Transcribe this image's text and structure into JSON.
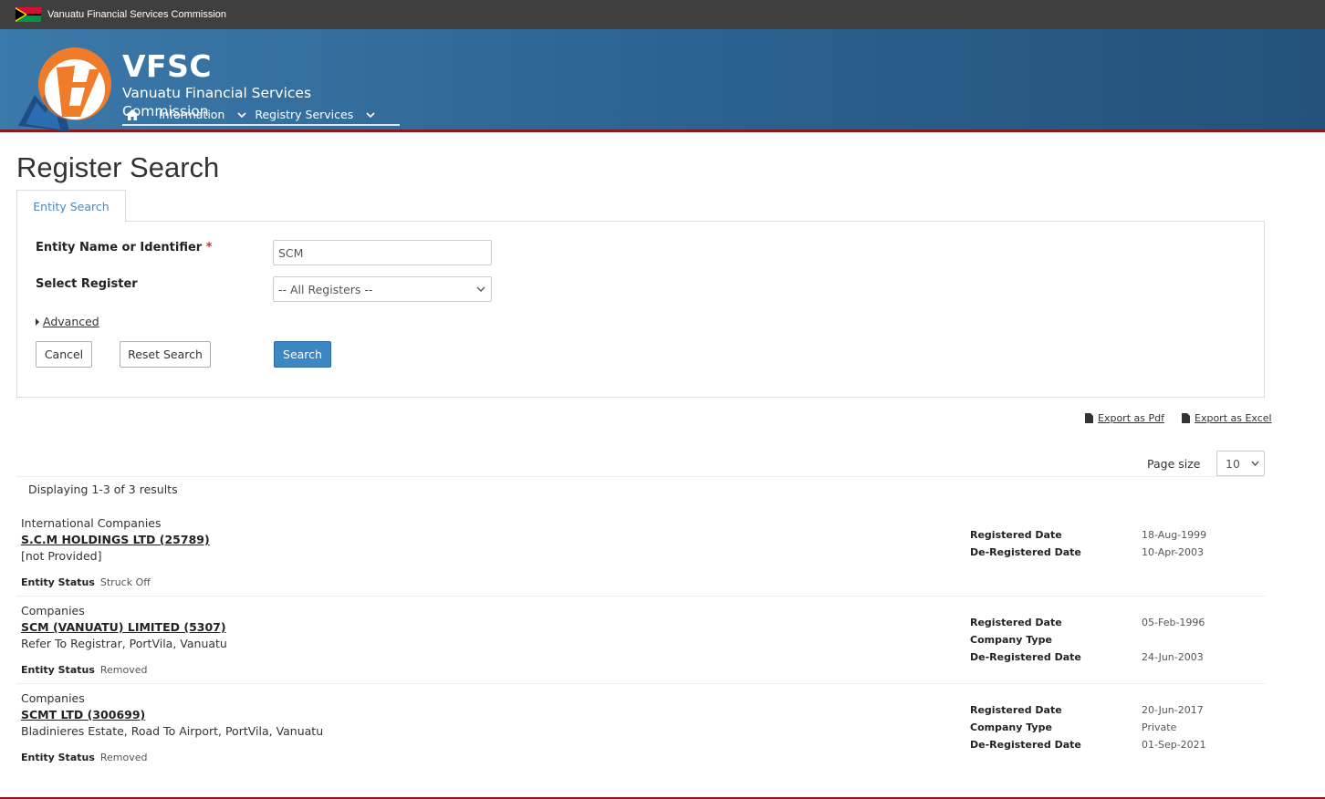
{
  "topbar": {
    "org_name": "Vanuatu Financial Services Commission"
  },
  "brand": {
    "abbr": "VFSC",
    "full_name": "Vanuatu Financial Services Commission"
  },
  "nav": {
    "items": [
      {
        "label": "Information"
      },
      {
        "label": "Registry Services"
      }
    ]
  },
  "page": {
    "title": "Register Search",
    "tab": "Entity Search"
  },
  "form": {
    "entity_label": "Entity Name or Identifier",
    "required_mark": "*",
    "entity_value": "SCM",
    "register_label": "Select Register",
    "register_value": "-- All Registers --",
    "advanced_label": "Advanced",
    "cancel_label": "Cancel",
    "reset_label": "Reset Search",
    "search_label": "Search"
  },
  "export": {
    "pdf_label": "Export as Pdf",
    "excel_label": "Export as Excel"
  },
  "pagination": {
    "page_size_label": "Page size",
    "page_size_value": "10",
    "summary": "Displaying 1-3 of 3 results"
  },
  "results": [
    {
      "type": "International Companies",
      "name": "S.C.M HOLDINGS LTD (25789)",
      "address": "[not Provided]",
      "status_label": "Entity Status",
      "status": "Struck Off",
      "details": [
        {
          "label": "Registered Date",
          "value": "18-Aug-1999"
        },
        {
          "label": "De-Registered Date",
          "value": "10-Apr-2003"
        }
      ]
    },
    {
      "type": "Companies",
      "name": "SCM (VANUATU) LIMITED (5307)",
      "address": "Refer To Registrar, PortVila, Vanuatu",
      "status_label": "Entity Status",
      "status": "Removed",
      "details": [
        {
          "label": "Registered Date",
          "value": "05-Feb-1996"
        },
        {
          "label": "Company Type",
          "value": ""
        },
        {
          "label": "De-Registered Date",
          "value": "24-Jun-2003"
        }
      ]
    },
    {
      "type": "Companies",
      "name": "SCMT LTD (300699)",
      "address": "Bladinieres Estate, Road To Airport, PortVila, Vanuatu",
      "status_label": "Entity Status",
      "status": "Removed",
      "details": [
        {
          "label": "Registered Date",
          "value": "20-Jun-2017"
        },
        {
          "label": "Company Type",
          "value": "Private"
        },
        {
          "label": "De-Registered Date",
          "value": "01-Sep-2021"
        }
      ]
    }
  ],
  "colors": {
    "banner": "#2f6896",
    "accent_red": "#8b1a1a",
    "primary_button": "#3c86c4",
    "logo_orange": "#f07c2a"
  }
}
